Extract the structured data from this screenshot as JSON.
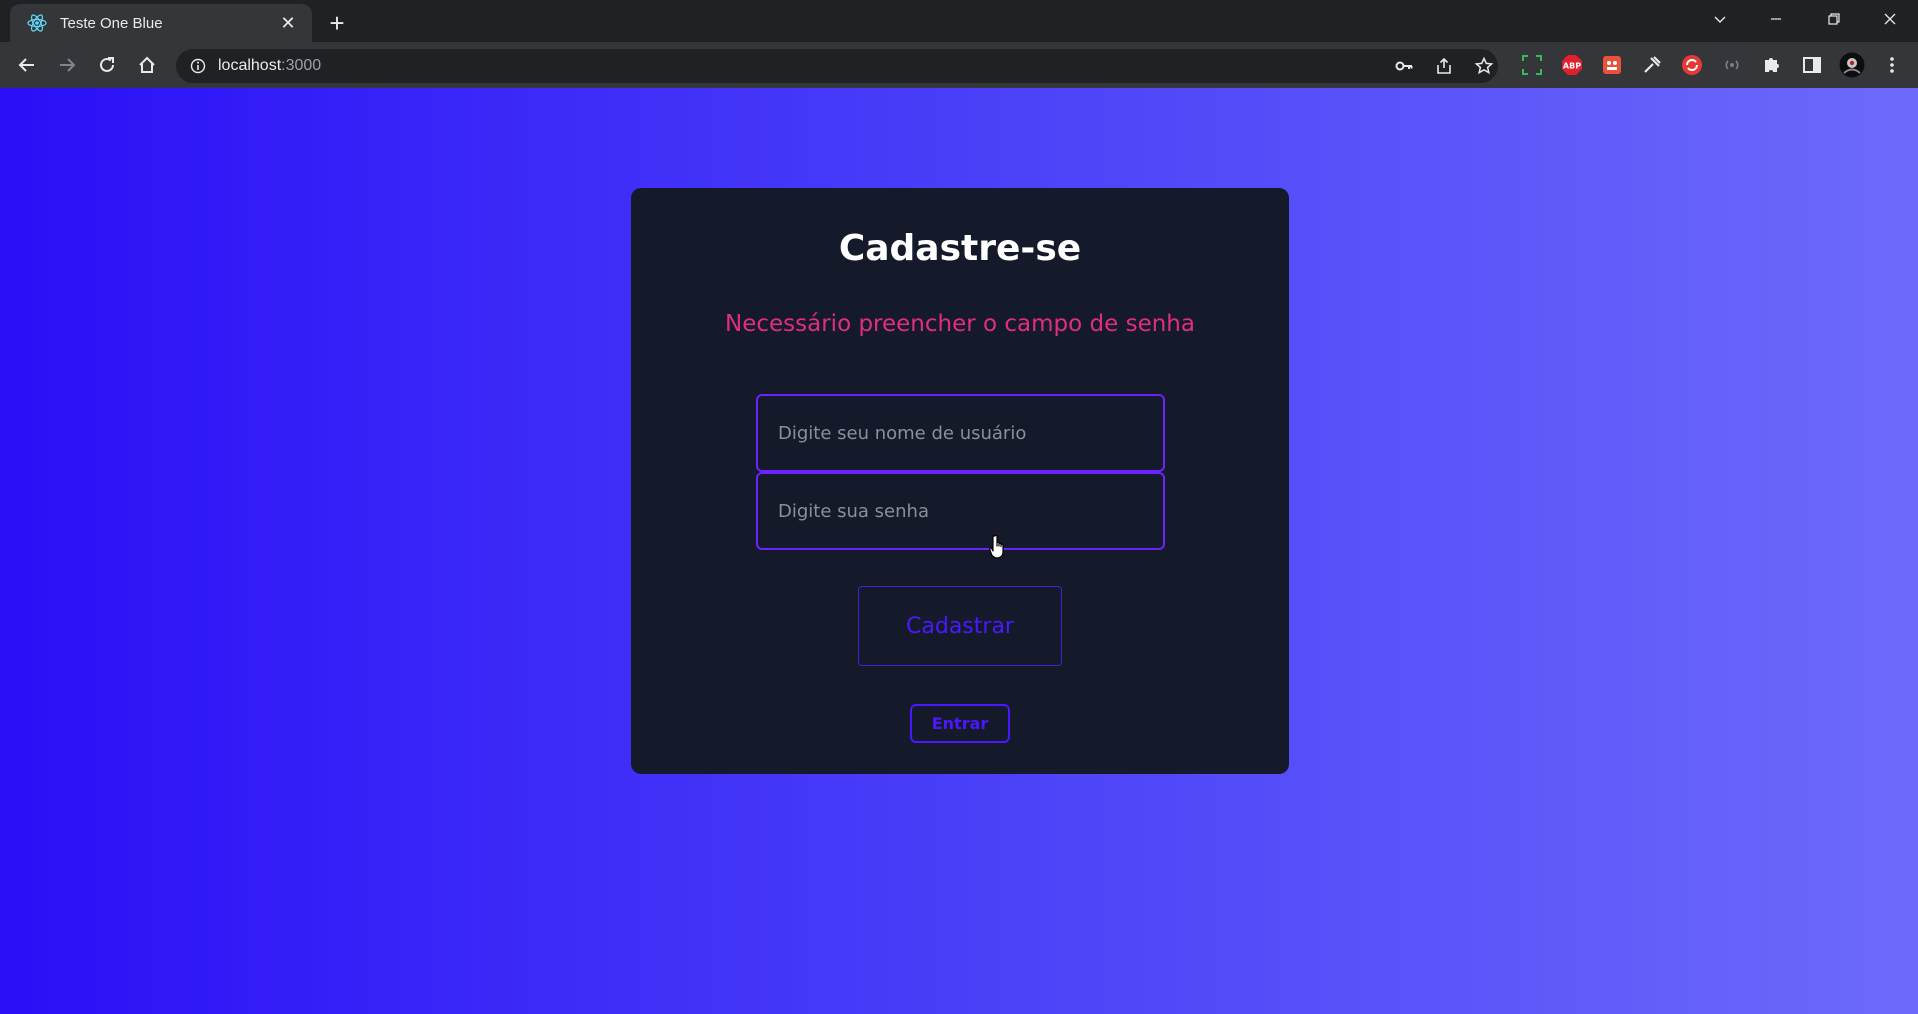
{
  "browser": {
    "tab_title": "Teste One Blue",
    "tab_close": "✕",
    "new_tab": "+",
    "url_host": "localhost",
    "url_port": ":3000"
  },
  "page": {
    "title": "Cadastre-se",
    "error_message": "Necessário preencher o campo de senha",
    "username_placeholder": "Digite seu nome de usuário",
    "password_placeholder": "Digite sua senha",
    "register_button": "Cadastrar",
    "login_button": "Entrar"
  },
  "colors": {
    "gradient_start": "#2a0ff7",
    "gradient_end": "#6d6afb",
    "card_bg": "#151a2b",
    "error": "#e02e7f",
    "accent": "#4a18ff"
  }
}
